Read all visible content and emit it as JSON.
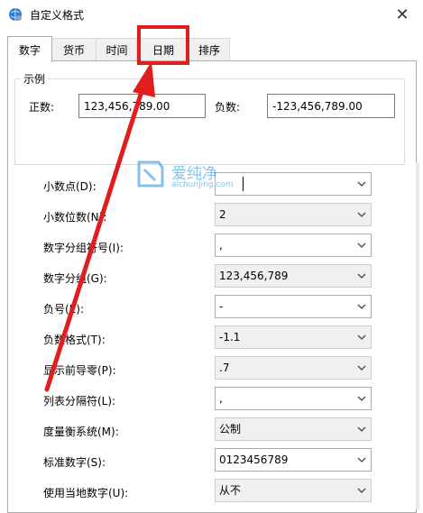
{
  "window": {
    "title": "自定义格式",
    "close_glyph": "✕"
  },
  "tabs": [
    {
      "label": "数字",
      "active": true
    },
    {
      "label": "货币",
      "active": false
    },
    {
      "label": "时间",
      "active": false
    },
    {
      "label": "日期",
      "active": false
    },
    {
      "label": "排序",
      "active": false
    }
  ],
  "sample": {
    "legend": "示例",
    "positive_label": "正数:",
    "positive_value": "123,456,789.00",
    "negative_label": "负数:",
    "negative_value": "-123,456,789.00"
  },
  "settings": [
    {
      "label": "小数点(D):",
      "value": "",
      "enabled": true,
      "focused": true
    },
    {
      "label": "小数位数(N):",
      "value": "2",
      "enabled": false
    },
    {
      "label": "数字分组符号(I):",
      "value": ",",
      "enabled": true
    },
    {
      "label": "数字分组(G):",
      "value": "123,456,789",
      "enabled": false
    },
    {
      "label": "负号(E):",
      "value": "-",
      "enabled": true
    },
    {
      "label": "负数格式(T):",
      "value": "-1.1",
      "enabled": false
    },
    {
      "label": "显示前导零(P):",
      "value": ".7",
      "enabled": false
    },
    {
      "label": "列表分隔符(L):",
      "value": ",",
      "enabled": true
    },
    {
      "label": "度量衡系统(M):",
      "value": "公制",
      "enabled": false
    },
    {
      "label": "标准数字(S):",
      "value": "0123456789",
      "enabled": true
    },
    {
      "label": "使用当地数字(U):",
      "value": "从不",
      "enabled": false
    }
  ],
  "watermark": {
    "name": "爱纯净",
    "url": "aichunjing.com"
  },
  "colors": {
    "annotation_red": "#e11e1e",
    "accent": "#1e90d8"
  }
}
